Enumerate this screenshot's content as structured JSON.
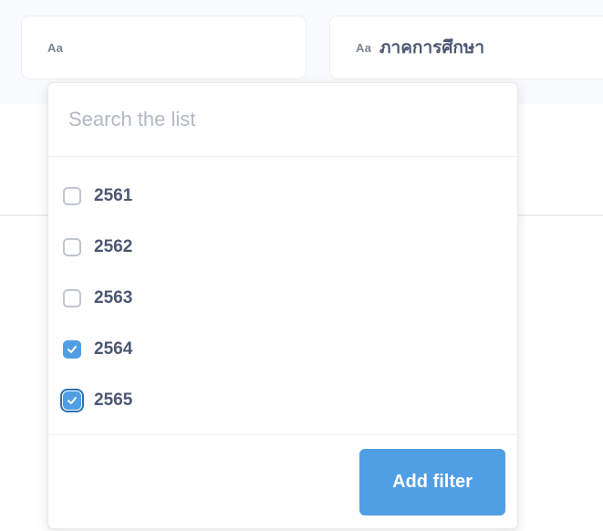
{
  "filters": [
    {
      "icon": "Aa",
      "label": ""
    },
    {
      "icon": "Aa",
      "label": "ภาคการศึกษา"
    }
  ],
  "popover": {
    "search_placeholder": "Search the list",
    "search_value": "",
    "options": [
      {
        "label": "2561",
        "checked": false
      },
      {
        "label": "2562",
        "checked": false
      },
      {
        "label": "2563",
        "checked": false
      },
      {
        "label": "2564",
        "checked": true
      },
      {
        "label": "2565",
        "checked": true
      }
    ],
    "add_button_label": "Add filter"
  },
  "colors": {
    "accent": "#509ee3",
    "text": "#4c5773",
    "muted": "#b3b9c2"
  }
}
